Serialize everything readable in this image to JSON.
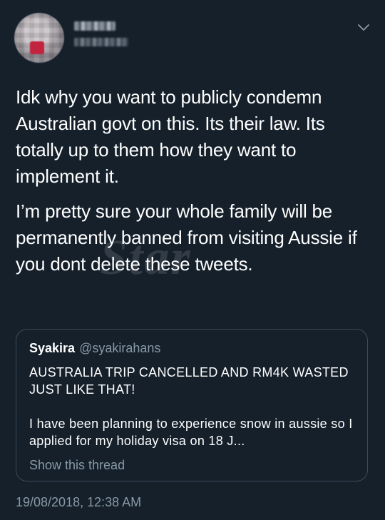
{
  "author": {
    "avatar_icon": "blurred-profile-avatar",
    "menu_icon": "chevron-down-icon"
  },
  "tweet": {
    "paragraphs": [
      "Idk why you want to publicly condemn Australian govt on this. Its their law. Its totally up to them how they want to implement it.",
      "I’m pretty sure your whole family will be permanently banned from visiting Aussie if you dont delete these tweets."
    ],
    "timestamp": "19/08/2018, 12:38 AM"
  },
  "watermark": "Star",
  "quoted_tweet": {
    "name": "Syakira",
    "handle": "@syakirahans",
    "paragraphs": [
      "AUSTRALIA TRIP CANCELLED AND RM4K WASTED JUST LIKE THAT!",
      "I have been planning to experience snow in aussie so I applied for my holiday visa on 18 J..."
    ],
    "show_thread_label": "Show this thread"
  },
  "colors": {
    "background": "#15202b",
    "text_primary": "#ffffff",
    "text_secondary": "#8899a6",
    "border": "#3d4b59"
  }
}
